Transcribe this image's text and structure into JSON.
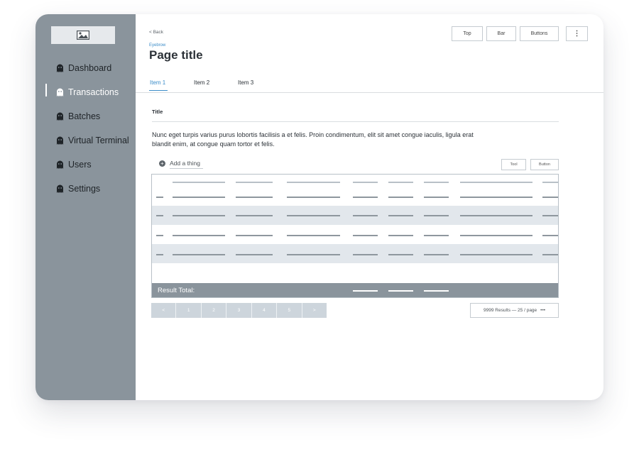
{
  "sidebar": {
    "items": [
      {
        "label": "Dashboard",
        "icon": "ghost-icon"
      },
      {
        "label": "Transactions",
        "icon": "ghost-icon",
        "active": true
      },
      {
        "label": "Batches",
        "icon": "ghost-icon"
      },
      {
        "label": "Virtual Terminal",
        "icon": "ghost-icon"
      },
      {
        "label": "Users",
        "icon": "ghost-icon"
      },
      {
        "label": "Settings",
        "icon": "ghost-icon"
      }
    ]
  },
  "header": {
    "back": "< Back",
    "eyebrow": "Eyebrow",
    "title": "Page title",
    "top_buttons": [
      "Top",
      "Bar",
      "Buttons"
    ],
    "more": "⋮"
  },
  "tabs": [
    "Item 1",
    "Item 2",
    "Item 3"
  ],
  "section": {
    "title": "Title",
    "body": "Nunc eget turpis varius purus lobortis facilisis a et felis. Proin condimentum, elit sit amet congue iaculis, ligula erat blandit enim, at congue quam tortor et felis."
  },
  "toolbar": {
    "add_label": "Add a thing",
    "tool_label": "Tool",
    "button_label": "Button"
  },
  "table": {
    "total_label": "Result Total:"
  },
  "pagination": {
    "pages": [
      "<",
      "1",
      "2",
      "3",
      "4",
      "5",
      ">"
    ],
    "results": "9999 Results — 25 / page",
    "more": "•••"
  },
  "colors": {
    "sidebar": "#8a949c",
    "accent": "#3c8dc9",
    "stripe": "#e2e7ec"
  }
}
